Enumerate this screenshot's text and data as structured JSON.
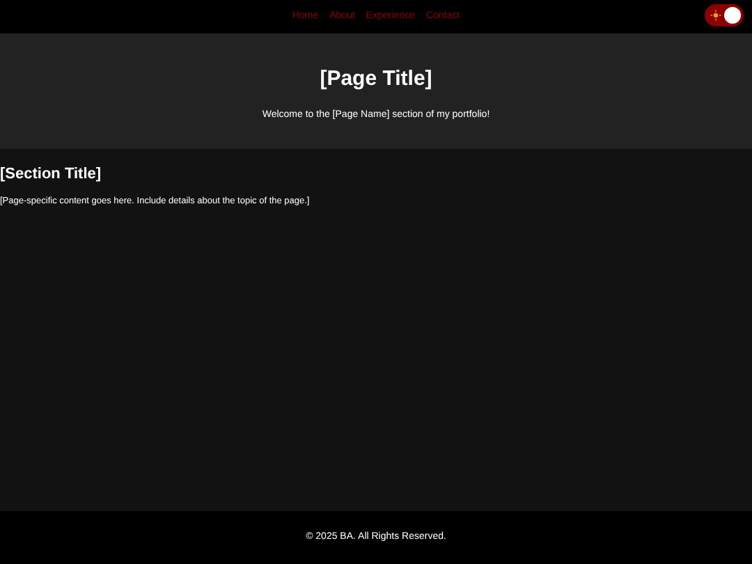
{
  "nav": {
    "links": [
      {
        "label": "Home"
      },
      {
        "label": "About"
      },
      {
        "label": "Experience"
      },
      {
        "label": "Contact"
      }
    ],
    "theme_toggle": {
      "on": true
    }
  },
  "header": {
    "title": "[Page Title]",
    "subtitle": "Welcome to the [Page Name] section of my portfolio!"
  },
  "section": {
    "title": "[Section Title]",
    "text": "[Page-specific content goes here. Include details about the topic of the page.]"
  },
  "footer": {
    "text": "© 2025 BA. All Rights Reserved."
  }
}
